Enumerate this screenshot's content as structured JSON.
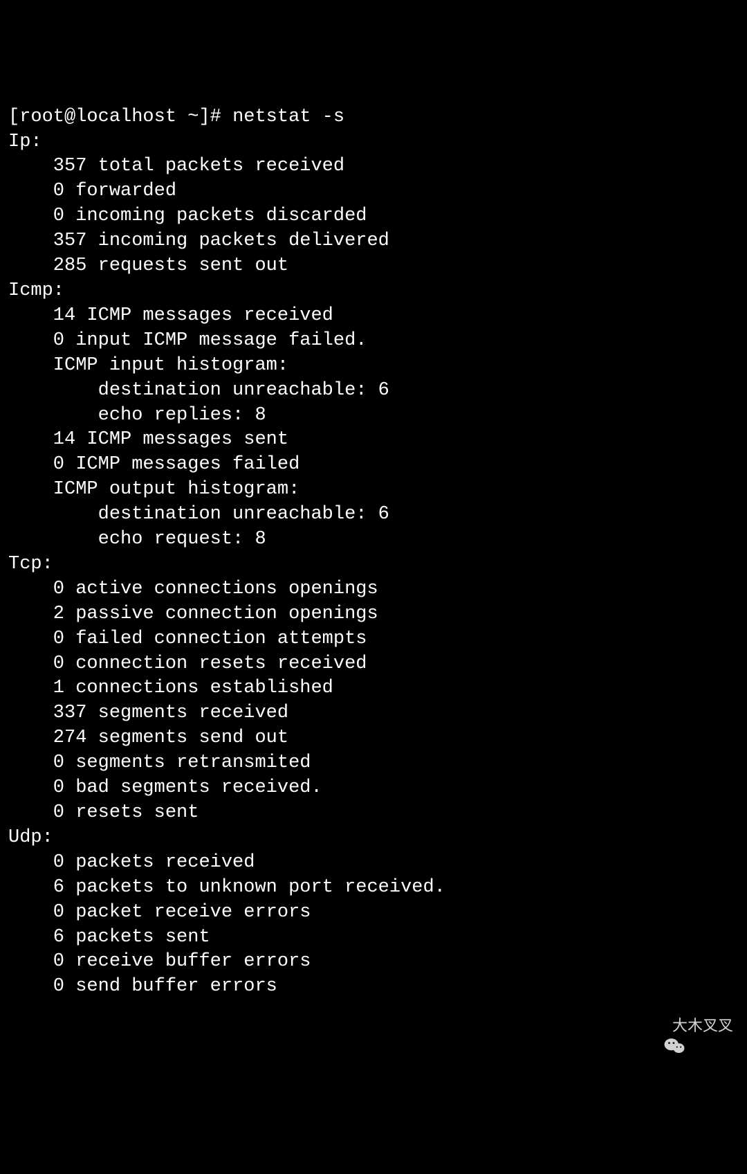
{
  "terminal": {
    "prompt": "[root@localhost ~]# ",
    "command": "netstat -s",
    "sections": {
      "ip": {
        "header": "Ip:",
        "lines": [
          "    357 total packets received",
          "    0 forwarded",
          "    0 incoming packets discarded",
          "    357 incoming packets delivered",
          "    285 requests sent out"
        ]
      },
      "icmp": {
        "header": "Icmp:",
        "lines": [
          "    14 ICMP messages received",
          "    0 input ICMP message failed.",
          "    ICMP input histogram:",
          "        destination unreachable: 6",
          "        echo replies: 8",
          "    14 ICMP messages sent",
          "    0 ICMP messages failed",
          "    ICMP output histogram:",
          "        destination unreachable: 6",
          "        echo request: 8"
        ]
      },
      "tcp": {
        "header": "Tcp:",
        "lines": [
          "    0 active connections openings",
          "    2 passive connection openings",
          "    0 failed connection attempts",
          "    0 connection resets received",
          "    1 connections established",
          "    337 segments received",
          "    274 segments send out",
          "    0 segments retransmited",
          "    0 bad segments received.",
          "    0 resets sent"
        ]
      },
      "udp": {
        "header": "Udp:",
        "lines": [
          "    0 packets received",
          "    6 packets to unknown port received.",
          "    0 packet receive errors",
          "    6 packets sent",
          "    0 receive buffer errors",
          "    0 send buffer errors"
        ]
      }
    }
  },
  "watermark": {
    "text": "大木叉叉"
  }
}
